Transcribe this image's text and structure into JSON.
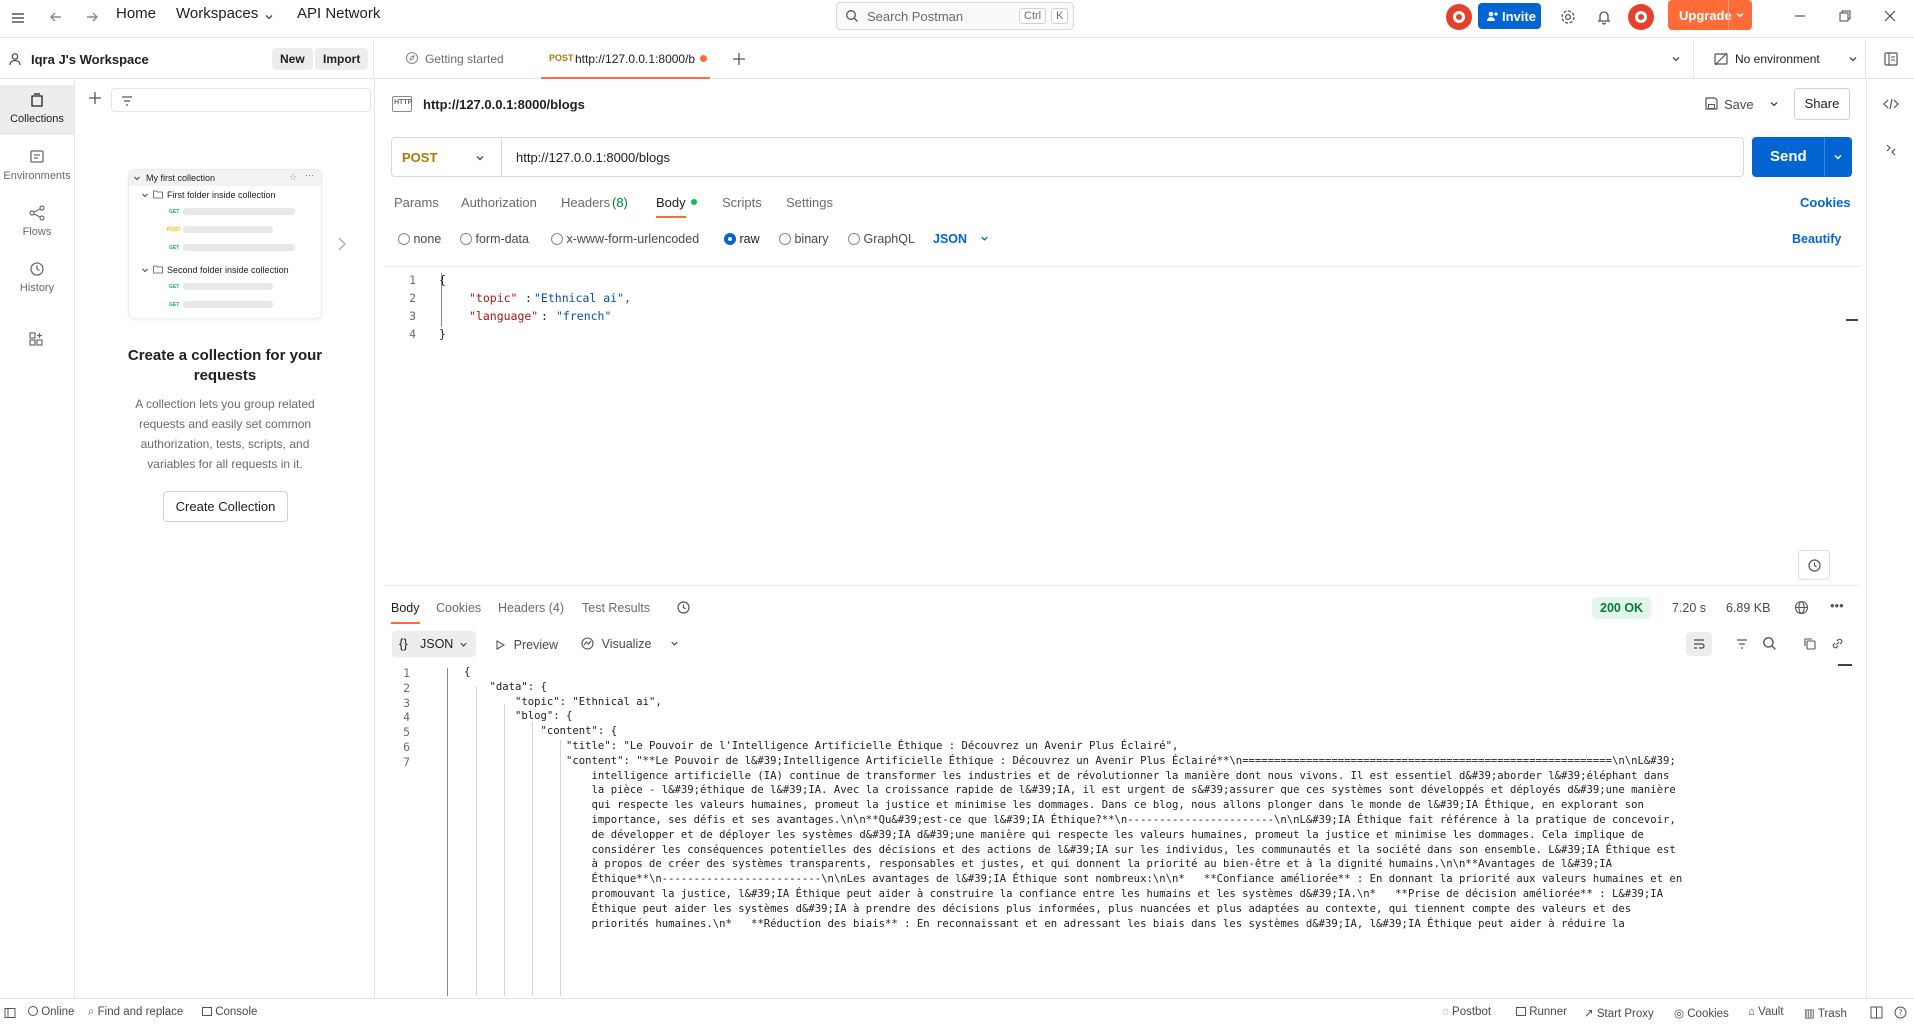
{
  "topbar": {
    "home": "Home",
    "workspaces": "Workspaces",
    "api_network": "API Network",
    "search_placeholder": "Search Postman",
    "search_kbd1": "Ctrl",
    "search_kbd2": "K",
    "invite": "Invite",
    "upgrade": "Upgrade"
  },
  "workspace": {
    "name": "Iqra J's Workspace",
    "new_label": "New",
    "import_label": "Import"
  },
  "rail": {
    "items": [
      {
        "label": "Collections",
        "icon": "collections-icon"
      },
      {
        "label": "Environments",
        "icon": "environments-icon"
      },
      {
        "label": "Flows",
        "icon": "flows-icon"
      },
      {
        "label": "History",
        "icon": "history-icon"
      }
    ]
  },
  "sidebar": {
    "illustration": {
      "collection_name": "My first collection",
      "folder1": "First folder inside collection",
      "folder2": "Second folder inside collection",
      "get": "GET",
      "post": "POST"
    },
    "empty_title": "Create a collection for your requests",
    "empty_desc": "A collection lets you group related requests and easily set common authorization, tests, scripts, and variables for all requests in it.",
    "create_button": "Create Collection"
  },
  "tabs": {
    "getting_started": "Getting started",
    "active_method": "POST",
    "active_url": "http://127.0.0.1:8000/b",
    "environment": "No environment"
  },
  "request": {
    "title": "http://127.0.0.1:8000/blogs",
    "save": "Save",
    "share": "Share",
    "method": "POST",
    "url": "http://127.0.0.1:8000/blogs",
    "send": "Send",
    "tabs": [
      "Params",
      "Authorization",
      "Headers",
      "Body",
      "Scripts",
      "Settings"
    ],
    "headers_count": "(8)",
    "cookies": "Cookies",
    "body_types": [
      "none",
      "form-data",
      "x-www-form-urlencoded",
      "raw",
      "binary",
      "GraphQL"
    ],
    "body_format": "JSON",
    "beautify": "Beautify",
    "body_lines": [
      {
        "n": "1",
        "text": "{"
      },
      {
        "n": "2",
        "key": "\"topic\"",
        "val": "\"Ethnical ai\","
      },
      {
        "n": "3",
        "key": "\"language\"",
        "val": "\"french\""
      },
      {
        "n": "4",
        "text": "}"
      }
    ]
  },
  "response": {
    "tabs": [
      "Body",
      "Cookies",
      "Headers (4)",
      "Test Results"
    ],
    "status": "200 OK",
    "time": "7.20 s",
    "size": "6.89 KB",
    "format": "JSON",
    "preview": "Preview",
    "visualize": "Visualize",
    "line_numbers": [
      "1",
      "2",
      "3",
      "4",
      "5",
      "6",
      "7"
    ],
    "lines": [
      "{",
      "    \"data\": {",
      "        \"topic\": \"Ethnical ai\",",
      "        \"blog\": {",
      "            \"content\": {",
      "                \"title\": \"Le Pouvoir de l'Intelligence Artificielle Éthique : Découvrez un Avenir Plus Éclairé\",",
      "                \"content\": \"**Le Pouvoir de l&#39;Intelligence Artificielle Éthique : Découvrez un Avenir Plus Éclairé**\\n==========================================================\\n\\nL&#39;",
      "                    intelligence artificielle (IA) continue de transformer les industries et de révolutionner la manière dont nous vivons. Il est essentiel d&#39;aborder l&#39;éléphant dans",
      "                    la pièce - l&#39;éthique de l&#39;IA. Avec la croissance rapide de l&#39;IA, il est urgent de s&#39;assurer que ces systèmes sont développés et déployés d&#39;une manière",
      "                    qui respecte les valeurs humaines, promeut la justice et minimise les dommages. Dans ce blog, nous allons plonger dans le monde de l&#39;IA Éthique, en explorant son",
      "                    importance, ses défis et ses avantages.\\n\\n**Qu&#39;est-ce que l&#39;IA Éthique?**\\n-----------------------\\n\\nL&#39;IA Éthique fait référence à la pratique de concevoir,",
      "                    de développer et de déployer les systèmes d&#39;IA d&#39;une manière qui respecte les valeurs humaines, promeut la justice et minimise les dommages. Cela implique de",
      "                    considérer les conséquences potentielles des décisions et des actions de l&#39;IA sur les individus, les communautés et la société dans son ensemble. L&#39;IA Éthique est",
      "                    à propos de créer des systèmes transparents, responsables et justes, et qui donnent la priorité au bien-être et à la dignité humains.\\n\\n**Avantages de l&#39;IA",
      "                    Éthique**\\n-------------------------\\n\\nLes avantages de l&#39;IA Éthique sont nombreux:\\n\\n*   **Confiance améliorée** : En donnant la priorité aux valeurs humaines et en",
      "                    promouvant la justice, l&#39;IA Éthique peut aider à construire la confiance entre les humains et les systèmes d&#39;IA.\\n*   **Prise de décision améliorée** : L&#39;IA",
      "                    Éthique peut aider les systèmes d&#39;IA à prendre des décisions plus informées, plus nuancées et plus adaptées au contexte, qui tiennent compte des valeurs et des",
      "                    priorités humaines.\\n*   **Réduction des biais** : En reconnaissant et en adressant les biais dans les systèmes d&#39;IA, l&#39;IA Éthique peut aider à réduire la"
    ]
  },
  "statusbar": {
    "online": "Online",
    "find_replace": "Find and replace",
    "console": "Console",
    "postbot": "Postbot",
    "runner": "Runner",
    "start_proxy": "Start Proxy",
    "cookies": "Cookies",
    "vault": "Vault",
    "trash": "Trash"
  },
  "colors": {
    "accent": "#ff6c37",
    "send_blue": "#0265d2",
    "success_green": "#007f31"
  }
}
